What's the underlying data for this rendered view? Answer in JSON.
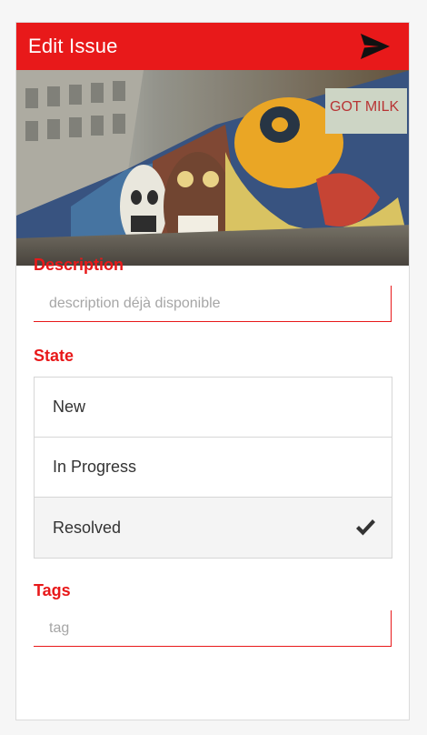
{
  "header": {
    "title": "Edit Issue",
    "send_icon": "send-icon"
  },
  "photo": {
    "icon": "graffiti-photo",
    "graffiti_text": "GOT MILK"
  },
  "description": {
    "label": "Description",
    "placeholder": "description déjà disponible",
    "value": ""
  },
  "state": {
    "label": "State",
    "options": [
      {
        "label": "New",
        "selected": false
      },
      {
        "label": "In Progress",
        "selected": false
      },
      {
        "label": "Resolved",
        "selected": true
      }
    ],
    "check_icon": "checkmark-icon"
  },
  "tags": {
    "label": "Tags",
    "placeholder": "tag",
    "value": ""
  },
  "colors": {
    "accent": "#e8191a",
    "border": "#d6d6d6",
    "selected_bg": "#f4f4f4"
  }
}
